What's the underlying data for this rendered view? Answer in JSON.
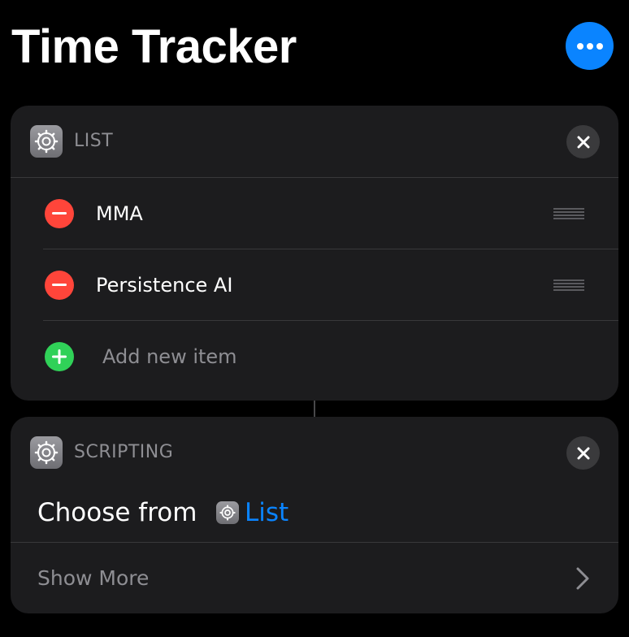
{
  "header": {
    "title": "Time Tracker",
    "more_icon": "ellipsis-icon",
    "accent_color": "#0a84ff"
  },
  "list_action": {
    "section_label": "LIST",
    "icon": "gear-icon",
    "items": [
      {
        "label": "MMA"
      },
      {
        "label": "Persistence AI"
      }
    ],
    "add_placeholder": "Add new item",
    "remove_color": "#ff453a",
    "add_color": "#30d158"
  },
  "scripting_action": {
    "section_label": "SCRIPTING",
    "icon": "gear-icon",
    "choose_label": "Choose from",
    "variable_name": "List",
    "show_more_label": "Show More"
  }
}
